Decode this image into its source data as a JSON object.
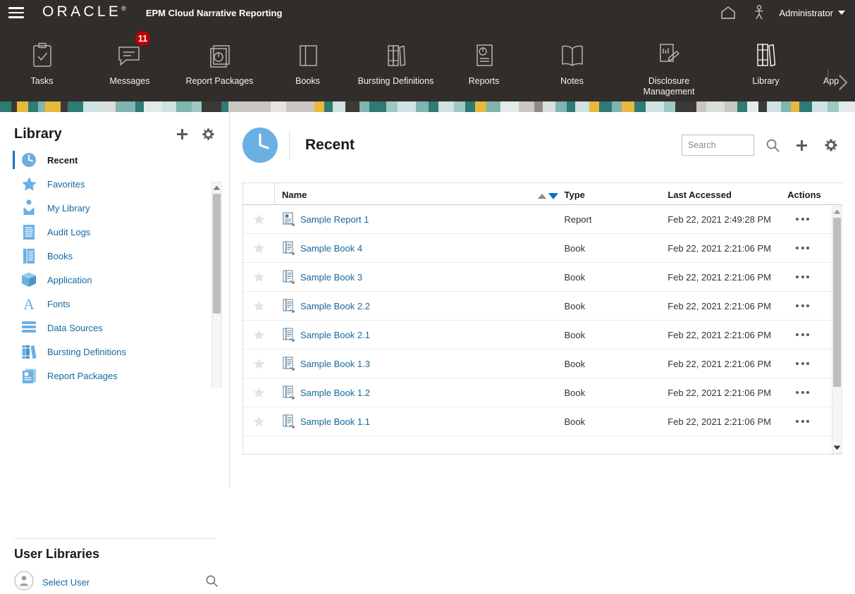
{
  "topbar": {
    "menu_icon": "hamburger-icon",
    "brand": "ORACLE",
    "brand_mark": "®",
    "app_title": "EPM Cloud Narrative Reporting",
    "home_icon": "home-icon",
    "accessibility_icon": "person-icon",
    "user_name": "Administrator"
  },
  "nav": {
    "items": [
      {
        "label": "Tasks",
        "icon": "clipboard-check-icon",
        "badge": null
      },
      {
        "label": "Messages",
        "icon": "message-icon",
        "badge": "11"
      },
      {
        "label": "Report Packages",
        "icon": "report-package-icon",
        "badge": null
      },
      {
        "label": "Books",
        "icon": "book-icon",
        "badge": null
      },
      {
        "label": "Bursting Definitions",
        "icon": "bursting-icon",
        "badge": null
      },
      {
        "label": "Reports",
        "icon": "report-icon",
        "badge": null
      },
      {
        "label": "Notes",
        "icon": "notes-icon",
        "badge": null
      },
      {
        "label": "Disclosure\nManagement",
        "icon": "disclosure-management-icon",
        "badge": null
      },
      {
        "label": "Library",
        "icon": "library-icon",
        "badge": null
      },
      {
        "label": "App",
        "icon": "",
        "badge": null
      }
    ],
    "next_icon": "chevron-right-icon"
  },
  "sidebar": {
    "title": "Library",
    "add_icon": "plus-icon",
    "settings_icon": "gear-icon",
    "items": [
      {
        "label": "Recent",
        "icon": "clock-icon",
        "active": true
      },
      {
        "label": "Favorites",
        "icon": "star-icon",
        "active": false
      },
      {
        "label": "My Library",
        "icon": "my-library-icon",
        "active": false
      },
      {
        "label": "Audit Logs",
        "icon": "audit-logs-icon",
        "active": false
      },
      {
        "label": "Books",
        "icon": "books-icon",
        "active": false
      },
      {
        "label": "Application",
        "icon": "application-cube-icon",
        "active": false
      },
      {
        "label": "Fonts",
        "icon": "fonts-icon",
        "active": false
      },
      {
        "label": "Data Sources",
        "icon": "data-sources-icon",
        "active": false
      },
      {
        "label": "Bursting Definitions",
        "icon": "bursting-definitions-icon",
        "active": false
      },
      {
        "label": "Report Packages",
        "icon": "report-packages-icon",
        "active": false
      }
    ],
    "user_libraries_title": "User Libraries",
    "select_user_label": "Select User",
    "select_user_icon": "user-avatar-icon",
    "select_user_search_icon": "search-icon"
  },
  "main": {
    "panel_icon": "clock-icon",
    "title": "Recent",
    "search": {
      "value": "",
      "placeholder": "Search"
    },
    "search_icon": "search-icon",
    "add_icon": "plus-icon",
    "settings_icon": "gear-icon",
    "table": {
      "columns": [
        "",
        "Name",
        "Type",
        "Last Accessed",
        "Actions"
      ],
      "sort_asc_icon": "sort-ascending-icon",
      "sort_desc_icon": "sort-descending-icon",
      "rows": [
        {
          "favorite_icon": "star-outline-icon",
          "icon": "report-file-icon",
          "name": "Sample Report 1",
          "type": "Report",
          "last_accessed": "Feb 22, 2021 2:49:28 PM",
          "actions_icon": "ellipsis-icon"
        },
        {
          "favorite_icon": "star-outline-icon",
          "icon": "book-file-icon",
          "name": "Sample Book 4",
          "type": "Book",
          "last_accessed": "Feb 22, 2021 2:21:06 PM",
          "actions_icon": "ellipsis-icon"
        },
        {
          "favorite_icon": "star-outline-icon",
          "icon": "book-file-icon",
          "name": "Sample Book 3",
          "type": "Book",
          "last_accessed": "Feb 22, 2021 2:21:06 PM",
          "actions_icon": "ellipsis-icon"
        },
        {
          "favorite_icon": "star-outline-icon",
          "icon": "book-file-icon",
          "name": "Sample Book 2.2",
          "type": "Book",
          "last_accessed": "Feb 22, 2021 2:21:06 PM",
          "actions_icon": "ellipsis-icon"
        },
        {
          "favorite_icon": "star-outline-icon",
          "icon": "book-file-icon",
          "name": "Sample Book 2.1",
          "type": "Book",
          "last_accessed": "Feb 22, 2021 2:21:06 PM",
          "actions_icon": "ellipsis-icon"
        },
        {
          "favorite_icon": "star-outline-icon",
          "icon": "book-file-icon",
          "name": "Sample Book 1.3",
          "type": "Book",
          "last_accessed": "Feb 22, 2021 2:21:06 PM",
          "actions_icon": "ellipsis-icon"
        },
        {
          "favorite_icon": "star-outline-icon",
          "icon": "book-file-icon",
          "name": "Sample Book 1.2",
          "type": "Book",
          "last_accessed": "Feb 22, 2021 2:21:06 PM",
          "actions_icon": "ellipsis-icon"
        },
        {
          "favorite_icon": "star-outline-icon",
          "icon": "book-file-icon",
          "name": "Sample Book 1.1",
          "type": "Book",
          "last_accessed": "Feb 22, 2021 2:21:06 PM",
          "actions_icon": "ellipsis-icon"
        }
      ]
    }
  },
  "colors": {
    "chrome_dark": "#312d2a",
    "link_blue": "#15699e",
    "accent_blue": "#0572ce",
    "icon_blue": "#6ab0e3",
    "badge_red": "#c00000"
  }
}
